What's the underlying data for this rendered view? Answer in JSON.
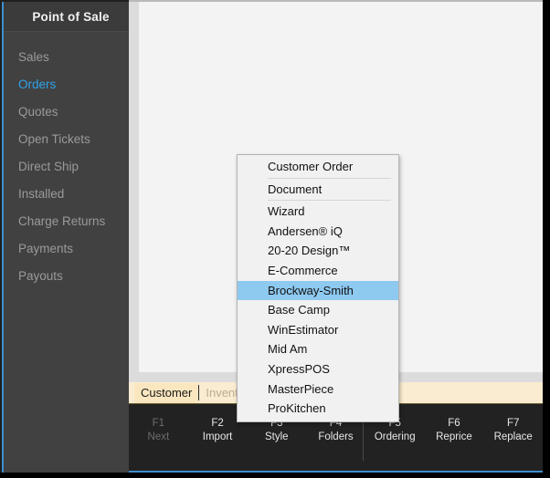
{
  "sidebar": {
    "title": "Point of Sale",
    "items": [
      {
        "label": "Sales",
        "active": false
      },
      {
        "label": "Orders",
        "active": true
      },
      {
        "label": "Quotes",
        "active": false
      },
      {
        "label": "Open Tickets",
        "active": false
      },
      {
        "label": "Direct Ship",
        "active": false
      },
      {
        "label": "Installed",
        "active": false
      },
      {
        "label": "Charge Returns",
        "active": false
      },
      {
        "label": "Payments",
        "active": false
      },
      {
        "label": "Payouts",
        "active": false
      }
    ]
  },
  "tabs": [
    {
      "label": "Customer",
      "active": true
    },
    {
      "label": "Inventory",
      "active": false
    }
  ],
  "function_keys": [
    {
      "key": "F1",
      "label": "Next",
      "disabled": true
    },
    {
      "key": "F2",
      "label": "Import",
      "disabled": false
    },
    {
      "key": "F3",
      "label": "Style",
      "disabled": false
    },
    {
      "key": "F4",
      "label": "Folders",
      "disabled": false
    },
    {
      "key": "F5",
      "label": "Ordering",
      "disabled": false
    },
    {
      "key": "F6",
      "label": "Reprice",
      "disabled": false
    },
    {
      "key": "F7",
      "label": "Replace",
      "disabled": false
    }
  ],
  "context_menu": {
    "items": [
      {
        "label": "Customer Order",
        "selected": false,
        "separator_after": true
      },
      {
        "label": "Document",
        "selected": false,
        "separator_after": true
      },
      {
        "label": "Wizard",
        "selected": false,
        "separator_after": false
      },
      {
        "label": "Andersen® iQ",
        "selected": false,
        "separator_after": false
      },
      {
        "label": "20-20 Design™",
        "selected": false,
        "separator_after": false
      },
      {
        "label": "E-Commerce",
        "selected": false,
        "separator_after": false
      },
      {
        "label": "Brockway-Smith",
        "selected": true,
        "separator_after": false
      },
      {
        "label": "Base Camp",
        "selected": false,
        "separator_after": false
      },
      {
        "label": "WinEstimator",
        "selected": false,
        "separator_after": false
      },
      {
        "label": "Mid Am",
        "selected": false,
        "separator_after": false
      },
      {
        "label": "XpressPOS",
        "selected": false,
        "separator_after": false
      },
      {
        "label": "MasterPiece",
        "selected": false,
        "separator_after": false
      },
      {
        "label": "ProKitchen",
        "selected": false,
        "separator_after": false
      }
    ]
  },
  "colors": {
    "accent_blue": "#3c8fd0",
    "active_nav": "#2fa3e8",
    "menu_highlight": "#8ec9f0",
    "tab_strip": "#faecd0",
    "sidebar_bg": "#414141",
    "footer_bg": "#222222"
  }
}
